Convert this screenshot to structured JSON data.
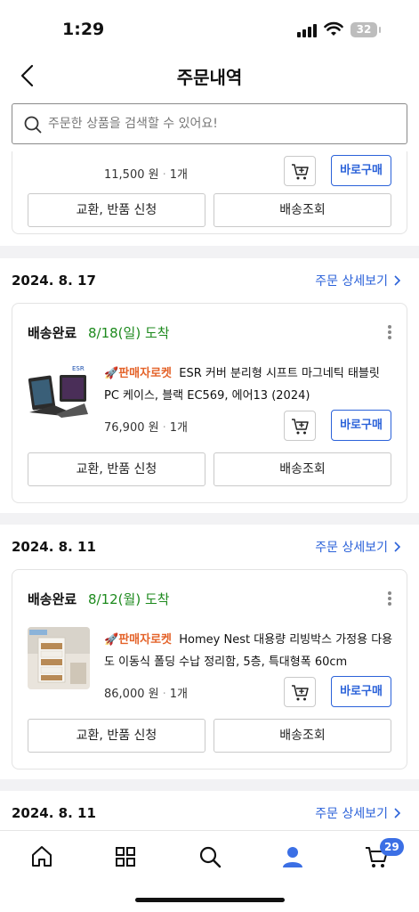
{
  "status_bar": {
    "time": "1:29",
    "battery": "32"
  },
  "header": {
    "title": "주문내역"
  },
  "search": {
    "placeholder": "주문한 상품을 검색할 수 있어요!"
  },
  "colors": {
    "accent": "#2b62d9",
    "arrive": "#1d8a1d",
    "rocket": "#e4632a",
    "badge": "#3b6fe5"
  },
  "top_partial": {
    "price": "11,500 원",
    "qty": "1개",
    "buy_label": "바로구매",
    "exchange_label": "교환, 반품 신청",
    "track_label": "배송조회"
  },
  "orders": [
    {
      "date": "2024. 8. 17",
      "detail_label": "주문 상세보기",
      "status": "배송완료",
      "arrive": "8/18(일) 도착",
      "rocket": "판매자로켓",
      "name": "ESR 커버 분리형 시프트 마그네틱 태블릿 PC 케이스, 블랙 EC569, 에어13 (2024)",
      "price": "76,900 원",
      "qty": "1개",
      "buy_label": "바로구매",
      "exchange_label": "교환, 반품 신청",
      "track_label": "배송조회",
      "thumb_brand": "ESR"
    },
    {
      "date": "2024. 8. 11",
      "detail_label": "주문 상세보기",
      "status": "배송완료",
      "arrive": "8/12(월) 도착",
      "rocket": "판매자로켓",
      "name": "Homey Nest 대용량 리빙박스 가정용 다용도 이동식 폴딩 수납 정리함, 5층, 특대형폭 60cm",
      "price": "86,000 원",
      "qty": "1개",
      "buy_label": "바로구매",
      "exchange_label": "교환, 반품 신청",
      "track_label": "배송조회"
    },
    {
      "date": "2024. 8. 11",
      "detail_label": "주문 상세보기"
    }
  ],
  "tabbar": {
    "items": [
      "home-icon",
      "category-icon",
      "search-icon",
      "my-coupang-icon",
      "cart-icon"
    ],
    "cart_badge": "29"
  }
}
